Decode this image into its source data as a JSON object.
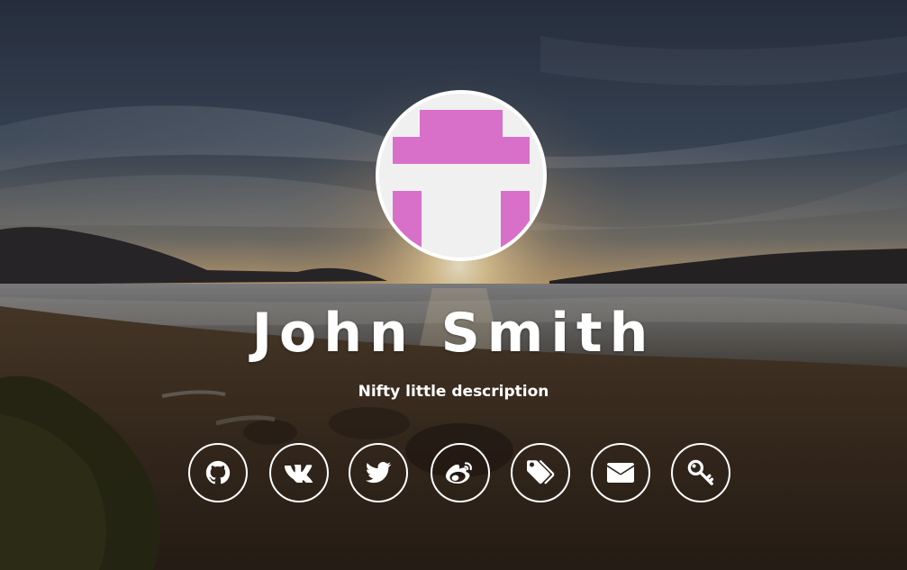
{
  "profile": {
    "name": "John Smith",
    "description": "Nifty little description",
    "avatar_icon": "identicon-avatar",
    "avatar_color": "#d870c9"
  },
  "social_links": [
    {
      "icon": "github-icon",
      "label": "GitHub"
    },
    {
      "icon": "vk-icon",
      "label": "VK"
    },
    {
      "icon": "twitter-icon",
      "label": "Twitter"
    },
    {
      "icon": "weibo-icon",
      "label": "Weibo"
    },
    {
      "icon": "tags-icon",
      "label": "Tags"
    },
    {
      "icon": "envelope-icon",
      "label": "Email"
    },
    {
      "icon": "key-icon",
      "label": "PGP Key"
    }
  ],
  "colors": {
    "text": "#ffffff",
    "ring": "#ffffff"
  }
}
